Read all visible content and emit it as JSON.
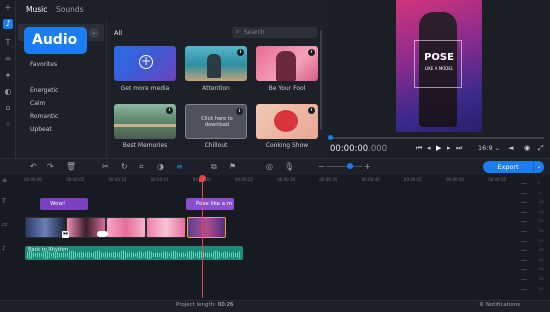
{
  "app": {
    "tabs": [
      {
        "label": "Music"
      },
      {
        "label": "Sounds"
      }
    ]
  },
  "sidebar": {
    "badge": "Audio",
    "categories": [
      "Favorites",
      "Energetic",
      "Calm",
      "Romantic",
      "Upbeat"
    ]
  },
  "library": {
    "section_label": "All",
    "search_placeholder": "Search",
    "items": [
      {
        "label": "Get more media"
      },
      {
        "label": "Attention"
      },
      {
        "label": "Be Your Fool"
      },
      {
        "label": "Best Memories"
      },
      {
        "label": "Chillout",
        "overlay": "Click here to download"
      },
      {
        "label": "Cooking Show"
      }
    ]
  },
  "preview": {
    "overlay_title": "POSE",
    "overlay_subtitle": "LIKE A MODEL",
    "timecode_main": "00:00:00",
    "timecode_frac": ".000",
    "aspect": "16:9",
    "progress": 0.0
  },
  "toolbar": {
    "export_label": "Export"
  },
  "timeline": {
    "ruler_ticks": [
      "00:00:00",
      "00:00:05",
      "00:00:10",
      "00:00:15",
      "00:00:20",
      "00:00:25",
      "00:00:30",
      "00:00:35",
      "00:00:40",
      "00:00:45",
      "00:00:50",
      "00:00:55"
    ],
    "title_clips": [
      {
        "label": "Wow!"
      },
      {
        "label": "Pose like a m"
      }
    ],
    "audio_clip_label": "Back to Rhythm",
    "meter_labels": [
      "0",
      "-5",
      "-10",
      "-15",
      "-20",
      "-25",
      "-30",
      "-35",
      "-40",
      "-45",
      "-50",
      "-55"
    ]
  },
  "status": {
    "project_length_label": "Project length:",
    "project_length_value": "00:26",
    "notifications_label": "Notifications"
  },
  "colors": {
    "accent": "#1a7ef0",
    "background": "#1d2028",
    "timeline_bg": "#171a21",
    "title_clip": "#7b3fbf",
    "audio_clip": "#1a8c78",
    "playhead": "#e34848"
  }
}
